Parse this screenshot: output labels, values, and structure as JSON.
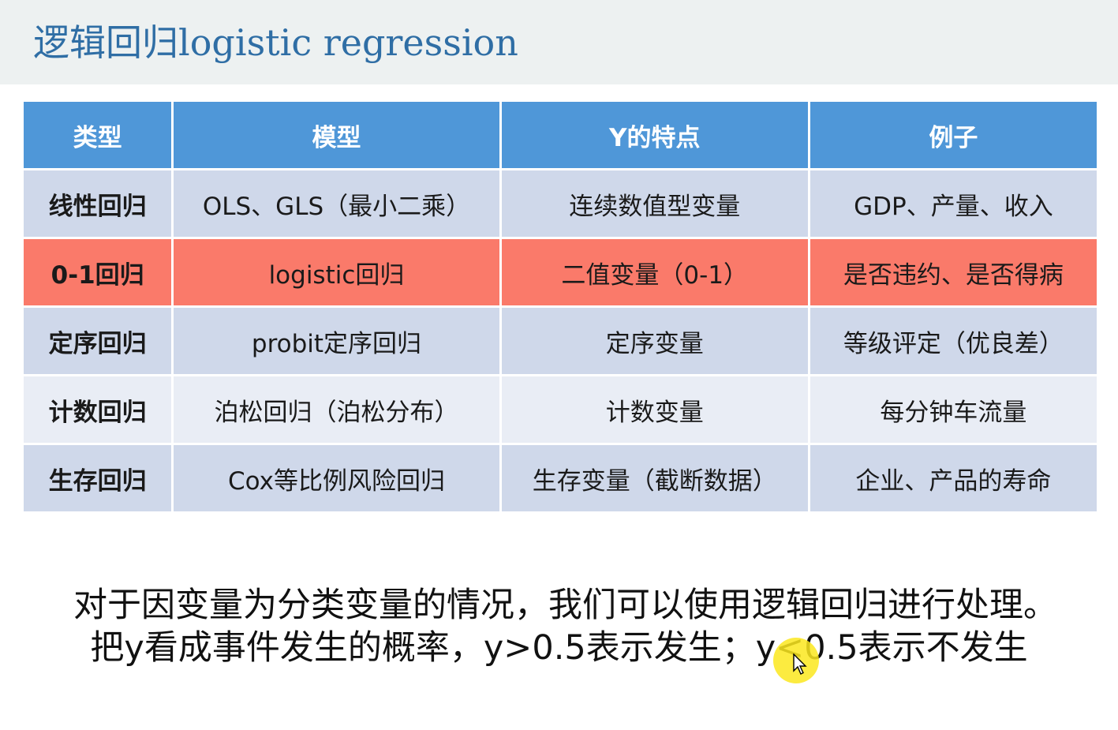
{
  "slide": {
    "title": "逻辑回归logistic regression"
  },
  "table": {
    "headers": [
      "类型",
      "模型",
      "Y的特点",
      "例子"
    ],
    "rows": [
      {
        "type": "线性回归",
        "model": "OLS、GLS（最小二乘）",
        "y_feature": "连续数值型变量",
        "example": "GDP、产量、收入"
      },
      {
        "type": "0-1回归",
        "model": "logistic回归",
        "y_feature": "二值变量（0-1）",
        "example": "是否违约、是否得病"
      },
      {
        "type": "定序回归",
        "model": "probit定序回归",
        "y_feature": "定序变量",
        "example": "等级评定（优良差）"
      },
      {
        "type": "计数回归",
        "model": "泊松回归（泊松分布）",
        "y_feature": "计数变量",
        "example": "每分钟车流量"
      },
      {
        "type": "生存回归",
        "model": "Cox等比例风险回归",
        "y_feature": "生存变量（截断数据）",
        "example": "企业、产品的寿命"
      }
    ],
    "highlighted_row": 1
  },
  "notes": {
    "line1": "对于因变量为分类变量的情况，我们可以使用逻辑回归进行处理。",
    "line2": "把y看成事件发生的概率，y>0.5表示发生；y<0.5表示不发生"
  },
  "colors": {
    "title": "#2f6ea5",
    "header_bg": "#4f97d8",
    "highlight_row": "#fa7a6a",
    "row_odd": "#cfd8ea",
    "row_even": "#e9edf5",
    "cursor_highlight": "#fce81e"
  },
  "cursor": {
    "icon": "pointer-arrow-icon"
  }
}
